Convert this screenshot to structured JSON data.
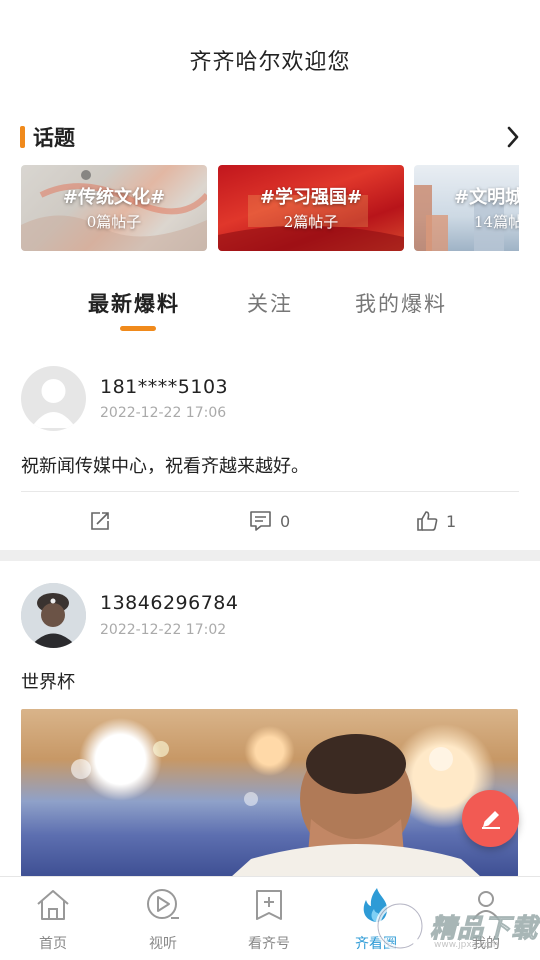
{
  "header": {
    "title": "齐齐哈尔欢迎您"
  },
  "topics": {
    "title": "话题",
    "items": [
      {
        "name": "#传统文化#",
        "count": "0篇帖子"
      },
      {
        "name": "#学习强国#",
        "count": "2篇帖子"
      },
      {
        "name": "#文明城",
        "count": "14篇帖"
      }
    ]
  },
  "tabs": [
    {
      "label": "最新爆料",
      "active": true
    },
    {
      "label": "关注",
      "active": false
    },
    {
      "label": "我的爆料",
      "active": false
    }
  ],
  "posts": [
    {
      "user": "181****5103",
      "time": "2022-12-22 17:06",
      "text": "祝新闻传媒中心，祝看齐越来越好。",
      "comments": "0",
      "likes": "1"
    },
    {
      "user": "13846296784",
      "time": "2022-12-22 17:02",
      "text": "世界杯"
    }
  ],
  "bottom_nav": [
    {
      "label": "首页",
      "icon": "home-icon"
    },
    {
      "label": "视听",
      "icon": "play-icon"
    },
    {
      "label": "看齐号",
      "icon": "add-box-icon"
    },
    {
      "label": "齐看圈",
      "icon": "flame-icon",
      "active": true
    },
    {
      "label": "我的",
      "icon": "user-icon"
    }
  ],
  "watermark": {
    "text": "精品下载",
    "url": "www.jpxz.com"
  },
  "colors": {
    "accent": "#f08a1c",
    "active_nav": "#2e9bd6",
    "fab": "#f25a53"
  }
}
